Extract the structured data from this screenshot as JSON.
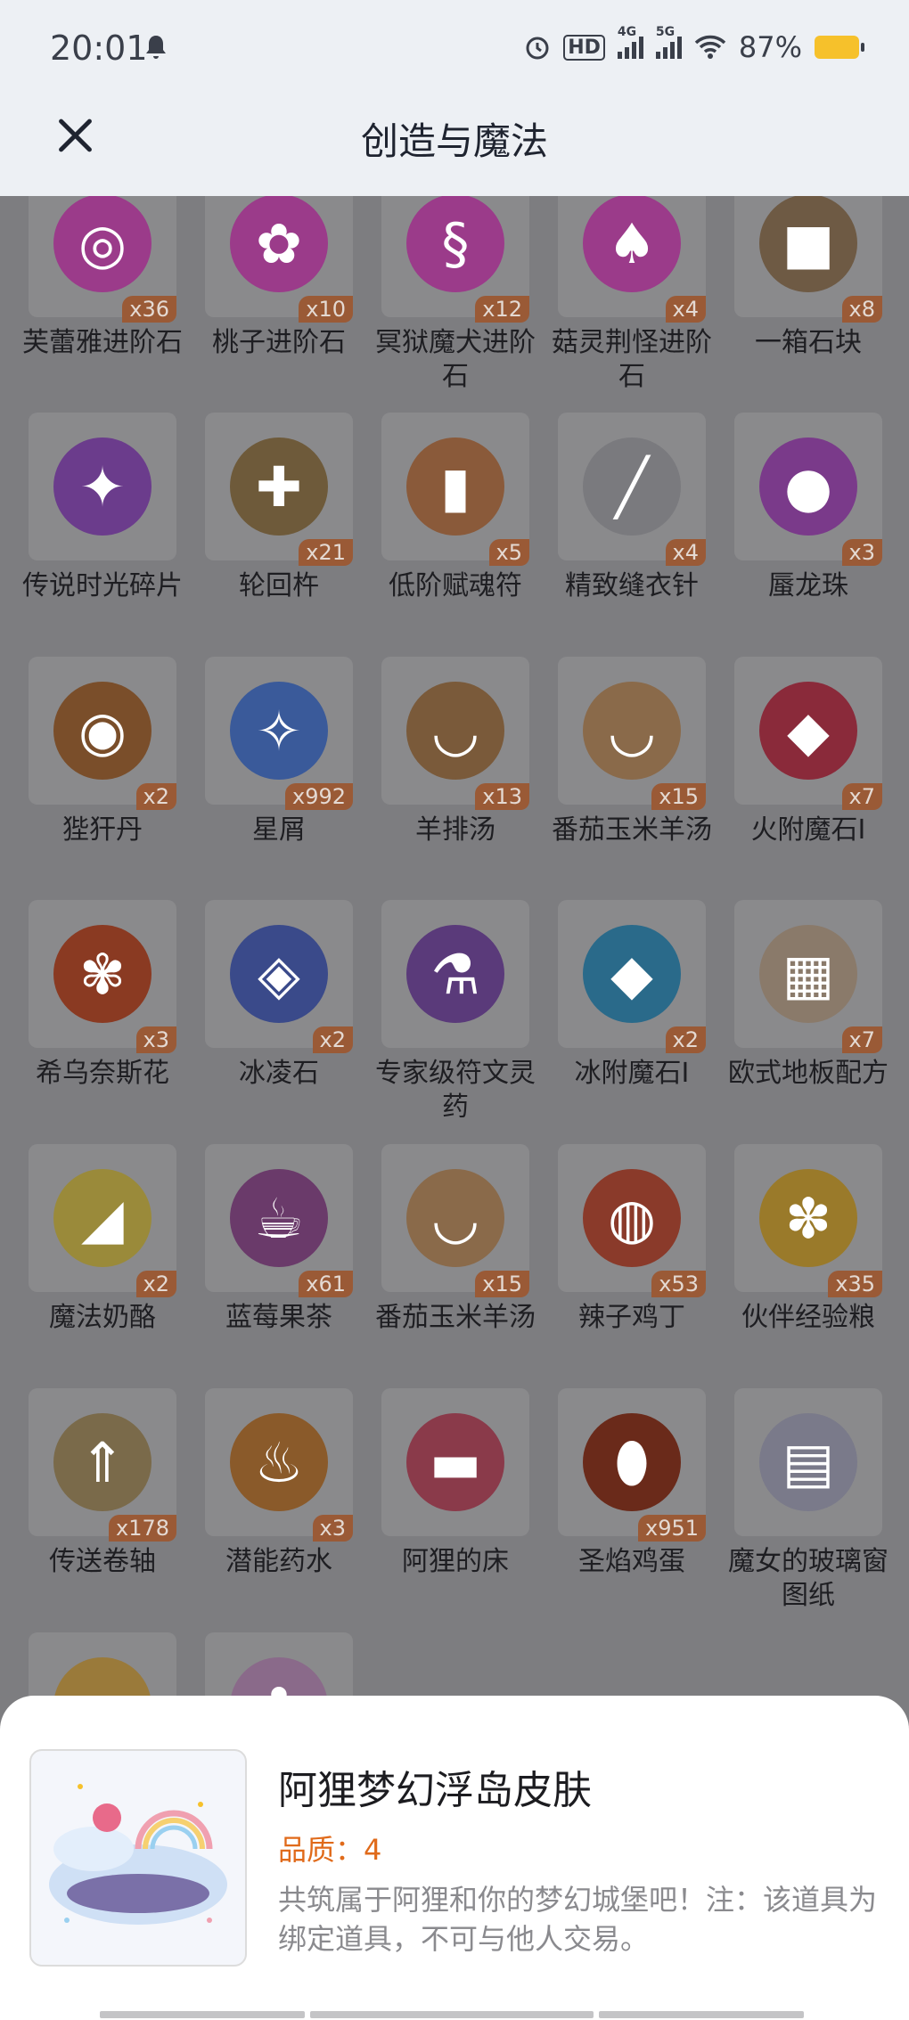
{
  "status_bar": {
    "time": "20:01",
    "battery": "87%",
    "network1": "4G",
    "network2": "5G",
    "hd": "HD"
  },
  "header": {
    "title": "创造与魔法",
    "close_icon": "close-icon"
  },
  "items": [
    {
      "name": "芙蕾雅进阶石",
      "qty": "x36",
      "icon": "octagon-gem-icon",
      "color": "#9b3b8a",
      "glyph": "◎"
    },
    {
      "name": "桃子进阶石",
      "qty": "x10",
      "icon": "octagon-gem-icon",
      "color": "#9b3b8a",
      "glyph": "✿"
    },
    {
      "name": "冥狱魔犬进阶石",
      "qty": "x12",
      "icon": "octagon-gem-icon",
      "color": "#9b3b8a",
      "glyph": "§"
    },
    {
      "name": "菇灵荆怪进阶石",
      "qty": "x4",
      "icon": "octagon-gem-icon",
      "color": "#9b3b8a",
      "glyph": "♠"
    },
    {
      "name": "一箱石块",
      "qty": "x8",
      "icon": "crate-icon",
      "color": "#6e5a44",
      "glyph": "■"
    },
    {
      "name": "传说时光碎片",
      "qty": "",
      "icon": "puzzle-piece-icon",
      "color": "#6b3c8c",
      "glyph": "✦"
    },
    {
      "name": "轮回杵",
      "qty": "x21",
      "icon": "pestle-icon",
      "color": "#6e5a3a",
      "glyph": "✚"
    },
    {
      "name": "低阶赋魂符",
      "qty": "x5",
      "icon": "talisman-icon",
      "color": "#8a5a3a",
      "glyph": "▮"
    },
    {
      "name": "精致缝衣针",
      "qty": "x4",
      "icon": "needle-icon",
      "color": "#7a7a7e",
      "glyph": "╱"
    },
    {
      "name": "蜃龙珠",
      "qty": "x3",
      "icon": "orb-icon",
      "color": "#7a3a8a",
      "glyph": "●"
    },
    {
      "name": "狴犴丹",
      "qty": "x2",
      "icon": "pill-icon",
      "color": "#7a4e2a",
      "glyph": "◉"
    },
    {
      "name": "星屑",
      "qty": "x992",
      "icon": "stardust-icon",
      "color": "#3a5a9a",
      "glyph": "✧"
    },
    {
      "name": "羊排汤",
      "qty": "x13",
      "icon": "soup-bowl-icon",
      "color": "#7a5a3a",
      "glyph": "◡"
    },
    {
      "name": "番茄玉米羊汤",
      "qty": "x15",
      "icon": "soup-bowl-icon",
      "color": "#8a6a4a",
      "glyph": "◡"
    },
    {
      "name": "火附魔石I",
      "qty": "x7",
      "icon": "red-crystal-icon",
      "color": "#8a2a3a",
      "glyph": "◆"
    },
    {
      "name": "希乌奈斯花",
      "qty": "x3",
      "icon": "flower-icon",
      "color": "#8a3a22",
      "glyph": "✾"
    },
    {
      "name": "冰凌石",
      "qty": "x2",
      "icon": "crystal-cluster-icon",
      "color": "#3a4a8a",
      "glyph": "◈"
    },
    {
      "name": "专家级符文灵药",
      "qty": "",
      "icon": "potion-icon",
      "color": "#5a3a7a",
      "glyph": "⚗"
    },
    {
      "name": "冰附魔石I",
      "qty": "x2",
      "icon": "blue-crystal-icon",
      "color": "#2a6a8a",
      "glyph": "◆"
    },
    {
      "name": "欧式地板配方",
      "qty": "x7",
      "icon": "scroll-icon",
      "color": "#8a7a6a",
      "glyph": "▦"
    },
    {
      "name": "魔法奶酪",
      "qty": "x2",
      "icon": "cheese-icon",
      "color": "#9a8a3a",
      "glyph": "◢"
    },
    {
      "name": "蓝莓果茶",
      "qty": "x61",
      "icon": "tea-cup-icon",
      "color": "#6a3a6a",
      "glyph": "☕"
    },
    {
      "name": "番茄玉米羊汤",
      "qty": "x15",
      "icon": "soup-bowl-icon",
      "color": "#8a6a4a",
      "glyph": "◡"
    },
    {
      "name": "辣子鸡丁",
      "qty": "x53",
      "icon": "dish-icon",
      "color": "#8a3a2a",
      "glyph": "◍"
    },
    {
      "name": "伙伴经验粮",
      "qty": "x35",
      "icon": "bag-icon",
      "color": "#9a7a2a",
      "glyph": "✽"
    },
    {
      "name": "传送卷轴",
      "qty": "x178",
      "icon": "scroll-icon",
      "color": "#7a6a4a",
      "glyph": "⇑"
    },
    {
      "name": "潜能药水",
      "qty": "x3",
      "icon": "potion-bottle-icon",
      "color": "#8a5a2a",
      "glyph": "♨"
    },
    {
      "name": "阿狸的床",
      "qty": "",
      "icon": "bed-icon",
      "color": "#8a3a4a",
      "glyph": "▬"
    },
    {
      "name": "圣焰鸡蛋",
      "qty": "x951",
      "icon": "egg-icon",
      "color": "#6a2a1a",
      "glyph": "⬮"
    },
    {
      "name": "魔女的玻璃窗图纸",
      "qty": "",
      "icon": "blueprint-icon",
      "color": "#7a7a8a",
      "glyph": "▤"
    },
    {
      "name": "",
      "qty": "",
      "icon": "cup-icon",
      "color": "#9a7a3a",
      "glyph": "◡"
    },
    {
      "name": "",
      "qty": "",
      "icon": "decor-icon",
      "color": "#8a6a8a",
      "glyph": "✿"
    }
  ],
  "detail": {
    "name": "阿狸梦幻浮岛皮肤",
    "quality": "品质：4",
    "description": "共筑属于阿狸和你的梦幻城堡吧！注：该道具为绑定道具，不可与他人交易。",
    "icon": "floating-island-skin-icon"
  }
}
